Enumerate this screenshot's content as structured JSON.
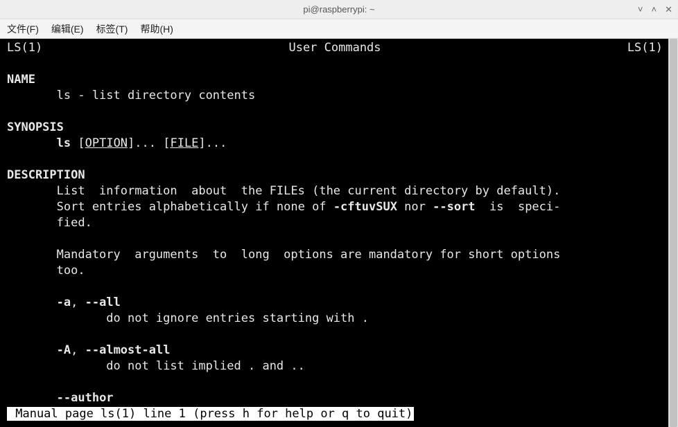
{
  "window": {
    "title": "pi@raspberrypi: ~"
  },
  "menubar": {
    "file": "文件(F)",
    "edit": "编辑(E)",
    "tabs": "标签(T)",
    "help": "帮助(H)"
  },
  "man": {
    "header_left": "LS(1)",
    "header_center": "User Commands",
    "header_right": "LS(1)",
    "sec_name": "NAME",
    "name_line": "       ls - list directory contents",
    "sec_synopsis": "SYNOPSIS",
    "syn_indent": "       ",
    "syn_ls": "ls",
    "syn_sp1": " [",
    "syn_option": "OPTION",
    "syn_mid": "]... [",
    "syn_file": "FILE",
    "syn_end": "]...",
    "sec_description": "DESCRIPTION",
    "desc_l1": "       List  information  about  the FILEs (the current directory by default).",
    "desc_l2a": "       Sort entries alphabetically if none of ",
    "desc_l2b": "-cftuvSUX",
    "desc_l2c": " nor ",
    "desc_l2d": "--sort",
    "desc_l2e": "  is  speci-",
    "desc_l3": "       fied.",
    "desc_l4": "       Mandatory  arguments  to  long  options are mandatory for short options",
    "desc_l5": "       too.",
    "opt1_indent": "       ",
    "opt1_a": "-a",
    "opt1_sep": ", ",
    "opt1_b": "--all",
    "opt1_desc": "              do not ignore entries starting with .",
    "opt2_indent": "       ",
    "opt2_a": "-A",
    "opt2_sep": ", ",
    "opt2_b": "--almost-all",
    "opt2_desc": "              do not list implied . and ..",
    "opt3_indent": "       ",
    "opt3_a": "--author",
    "status": " Manual page ls(1) line 1 (press h for help or q to quit)"
  }
}
